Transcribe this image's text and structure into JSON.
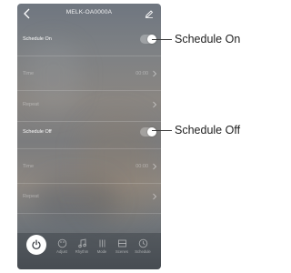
{
  "header": {
    "title": "MELK-OA0000A"
  },
  "schedule_on": {
    "label": "Schedule On",
    "enabled": true
  },
  "on_time": {
    "label": "Time",
    "value": "00:00"
  },
  "on_repeat": {
    "label": "Repeat"
  },
  "schedule_off": {
    "label": "Schedule Off",
    "enabled": true
  },
  "off_time": {
    "label": "Time",
    "value": "00:00"
  },
  "off_repeat": {
    "label": "Repeat"
  },
  "tabs": [
    {
      "label": "Adjust",
      "icon": "palette-icon"
    },
    {
      "label": "Rhythm",
      "icon": "music-note-icon"
    },
    {
      "label": "Mode",
      "icon": "mode-icon"
    },
    {
      "label": "Scenes",
      "icon": "scenes-icon"
    },
    {
      "label": "Schedule",
      "icon": "clock-icon"
    }
  ],
  "callouts": {
    "on": "Schedule On",
    "off": "Schedule Off"
  },
  "colors": {
    "toggle_knob": "#ffffff",
    "text": "#ffffff",
    "callout_line": "#3a3a3a"
  }
}
